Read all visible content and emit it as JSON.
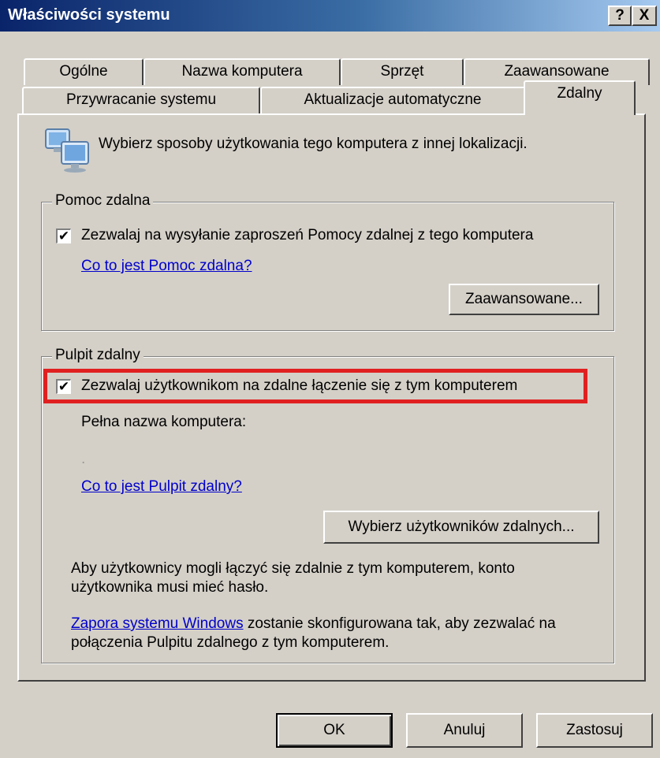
{
  "window": {
    "title": "Właściwości systemu",
    "help_glyph": "?",
    "close_glyph": "X"
  },
  "tabs_back": [
    "Ogólne",
    "Nazwa komputera",
    "Sprzęt",
    "Zaawansowane"
  ],
  "tabs_front": [
    "Przywracanie systemu",
    "Aktualizacje automatyczne",
    "Zdalny"
  ],
  "selected_tab": "Zdalny",
  "intro": "Wybierz sposoby użytkowania tego komputera z innej lokalizacji.",
  "remote_assistance": {
    "legend": "Pomoc zdalna",
    "checkbox_label": "Zezwalaj na wysyłanie zaproszeń Pomocy zdalnej z tego komputera",
    "checked": true,
    "help_link": "Co to jest Pomoc zdalna?",
    "advanced_button": "Zaawansowane..."
  },
  "remote_desktop": {
    "legend": "Pulpit zdalny",
    "checkbox_label": "Zezwalaj użytkownikom na zdalne łączenie się z tym komputerem",
    "checked": true,
    "computer_name_label": "Pełna nazwa komputera:",
    "computer_name_value": ".",
    "help_link": "Co to jest Pulpit zdalny?",
    "select_users_button": "Wybierz użytkowników zdalnych...",
    "password_note": "Aby użytkownicy mogli łączyć się zdalnie z tym komputerem, konto użytkownika musi mieć hasło.",
    "firewall_link": "Zapora systemu Windows",
    "firewall_note": " zostanie skonfigurowana tak, aby zezwalać na połączenia Pulpitu zdalnego z tym komputerem."
  },
  "buttons": {
    "ok": "OK",
    "cancel": "Anuluj",
    "apply": "Zastosuj"
  },
  "colors": {
    "titlebar_start": "#0a246a",
    "highlight": "#e02020",
    "link": "#0000cc"
  }
}
